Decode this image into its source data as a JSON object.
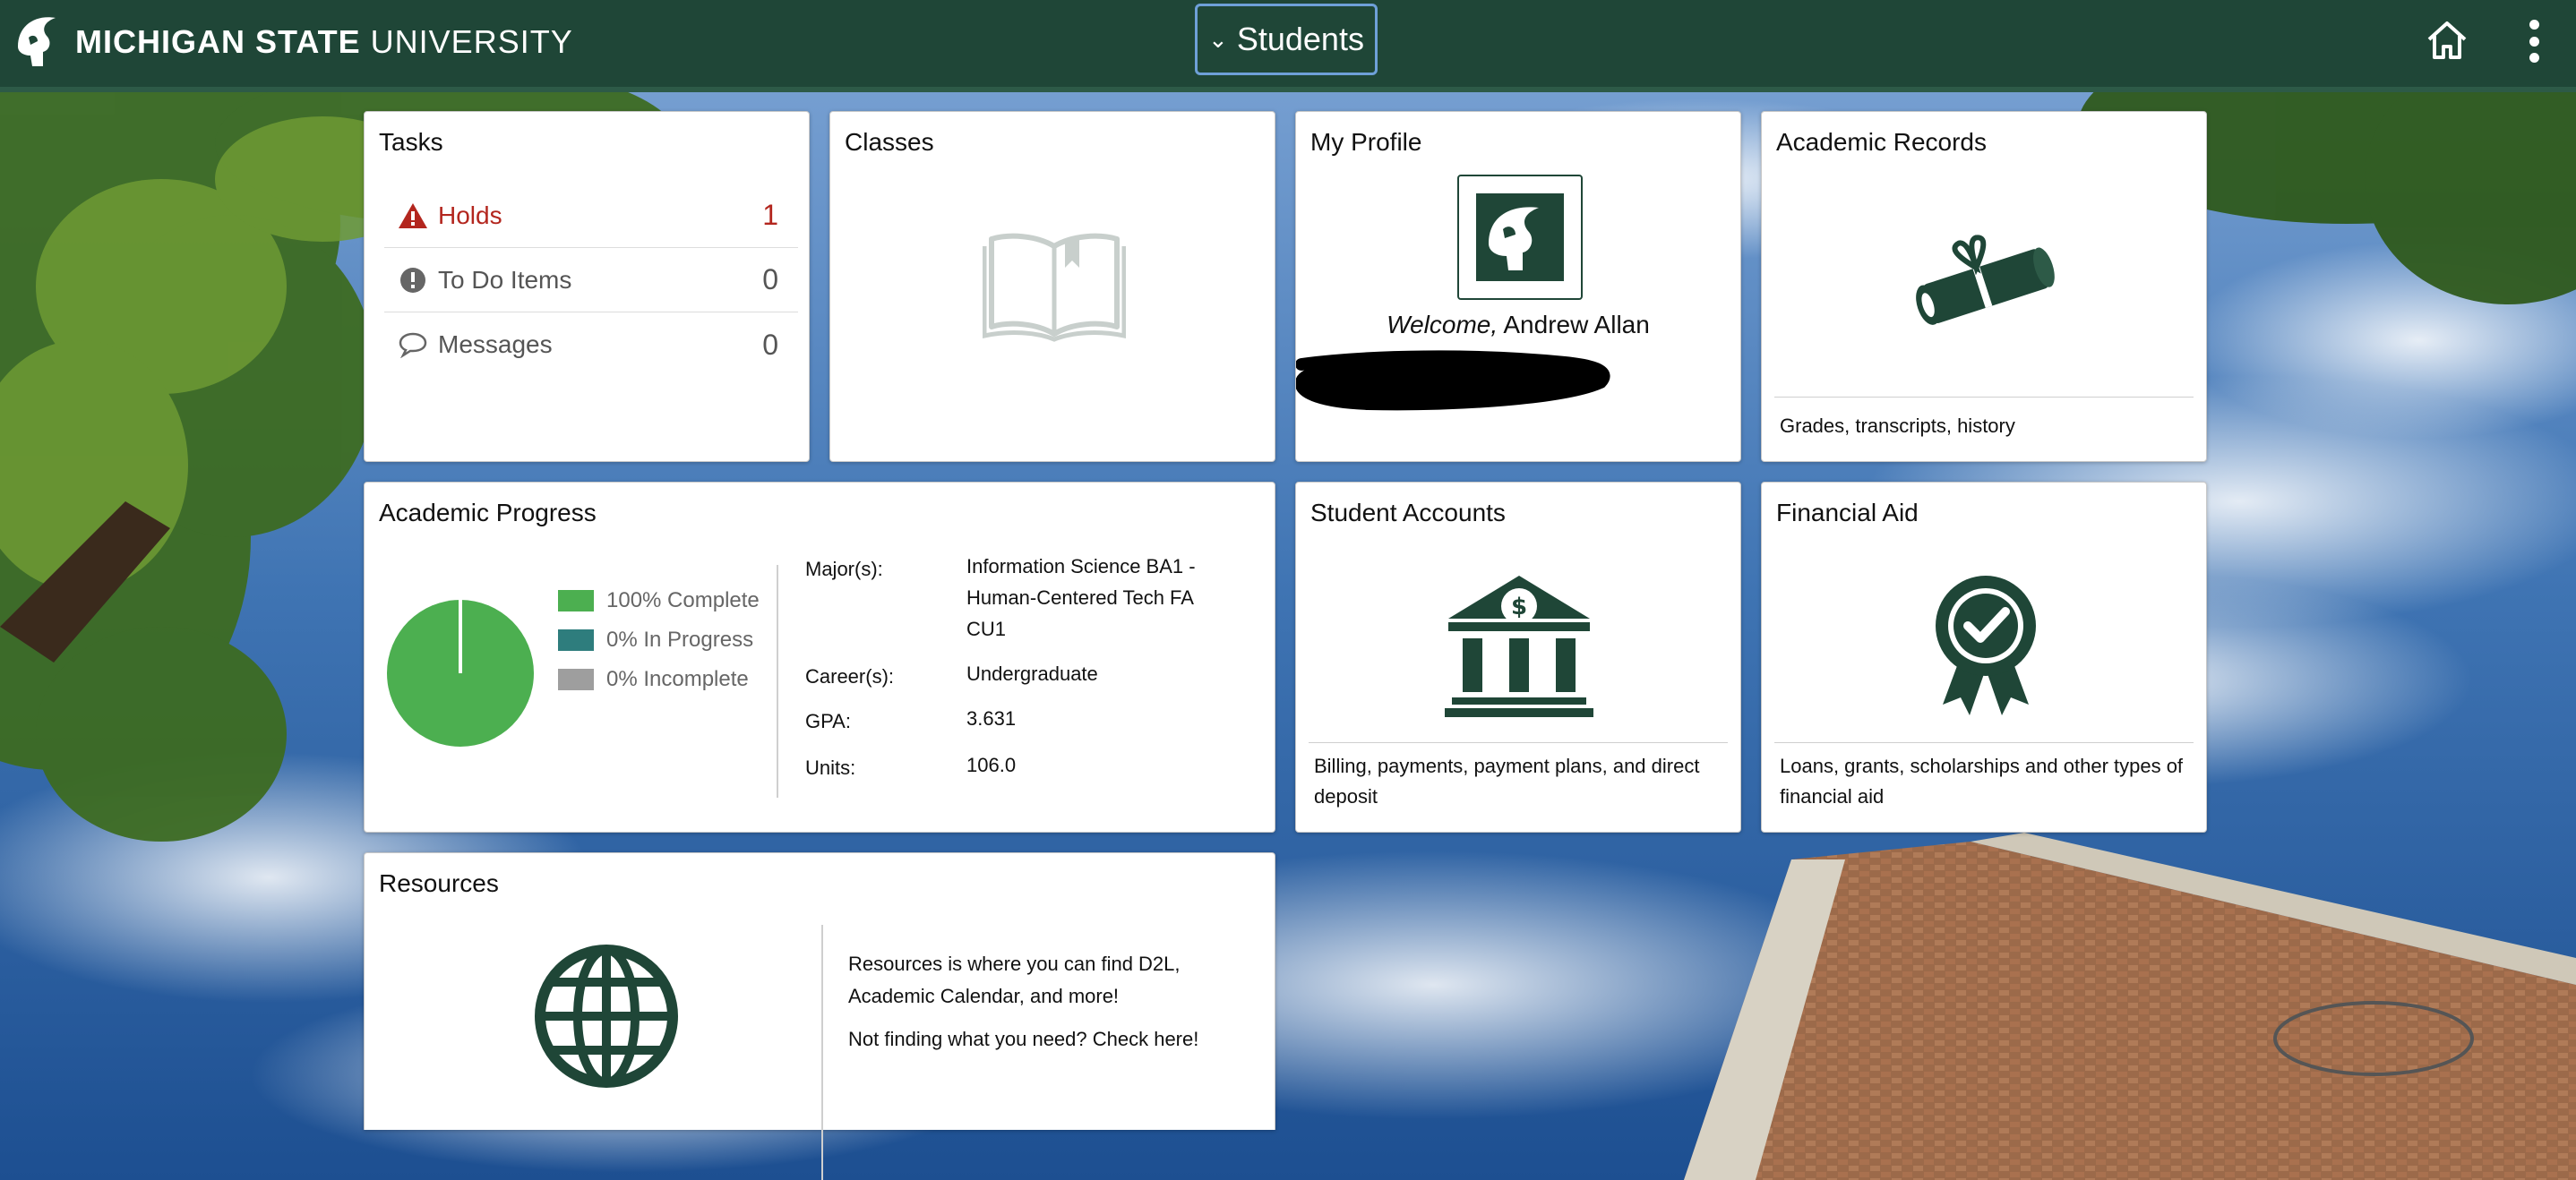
{
  "header": {
    "logo_bold": "MICHIGAN STATE",
    "logo_thin": "UNIVERSITY",
    "nav_label": "Students",
    "home_icon": "home-icon",
    "menu_icon": "more-vertical-icon"
  },
  "tasks": {
    "title": "Tasks",
    "items": [
      {
        "label": "Holds",
        "count": "1",
        "icon": "warning-triangle-icon"
      },
      {
        "label": "To Do Items",
        "count": "0",
        "icon": "exclamation-circle-icon"
      },
      {
        "label": "Messages",
        "count": "0",
        "icon": "speech-bubble-icon"
      }
    ]
  },
  "classes": {
    "title": "Classes",
    "icon": "open-book-icon"
  },
  "profile": {
    "title": "My Profile",
    "welcome": "Welcome,",
    "name": "Andrew Allan",
    "icon": "spartan-helmet-icon"
  },
  "academic_records": {
    "title": "Academic Records",
    "caption": "Grades, transcripts, history",
    "icon": "diploma-icon"
  },
  "academic_progress": {
    "title": "Academic Progress",
    "legend": [
      {
        "label": "100% Complete",
        "color": "#4caf50"
      },
      {
        "label": "0% In Progress",
        "color": "#2e7d7d"
      },
      {
        "label": "0% Incomplete",
        "color": "#9e9e9e"
      }
    ],
    "complete_fraction": 1.0,
    "fields": [
      {
        "label": "Major(s):",
        "value": "Information Science BA1 - Human-Centered Tech FA CU1"
      },
      {
        "label": "Career(s):",
        "value": "Undergraduate"
      },
      {
        "label": "GPA:",
        "value": "3.631"
      },
      {
        "label": "Units:",
        "value": "106.0"
      }
    ]
  },
  "student_accounts": {
    "title": "Student Accounts",
    "caption": "Billing, payments, payment plans, and direct deposit",
    "icon": "bank-icon"
  },
  "financial_aid": {
    "title": "Financial Aid",
    "caption": "Loans, grants, scholarships and other types of financial aid",
    "icon": "award-ribbon-icon"
  },
  "resources": {
    "title": "Resources",
    "text1": "Resources is where you can find D2L, Academic Calendar, and more!",
    "text2": "Not finding what you need? Check here!",
    "icon": "globe-icon"
  },
  "colors": {
    "brand_green": "#1f4637",
    "alert_red": "#b3261e",
    "nav_focus": "#6ea0d8"
  }
}
